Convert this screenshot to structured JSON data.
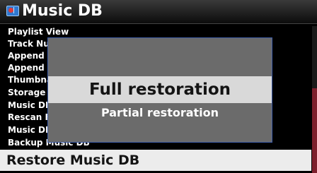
{
  "header": {
    "title": "Music DB",
    "icon": "music-db-icon"
  },
  "menu": {
    "items": [
      {
        "label": "Playlist View"
      },
      {
        "label": "Track Number"
      },
      {
        "label": "Append A"
      },
      {
        "label": "Append A"
      },
      {
        "label": "Thumbnail"
      },
      {
        "label": "Storage"
      },
      {
        "label": "Music DB"
      },
      {
        "label": "Rescan F"
      },
      {
        "label": "Music DB"
      },
      {
        "label": "Backup Music DB"
      }
    ],
    "selected_label": "Restore Music DB"
  },
  "dialog": {
    "options": [
      {
        "label": "Full restoration",
        "selected": true
      },
      {
        "label": "Partial restoration",
        "selected": false
      }
    ]
  },
  "colors": {
    "background": "#000000",
    "highlight": "#ececec",
    "dialog_bg": "#6b6b6b",
    "dialog_border": "#3f5ea8",
    "scroll_thumb": "#7d1f2c"
  }
}
